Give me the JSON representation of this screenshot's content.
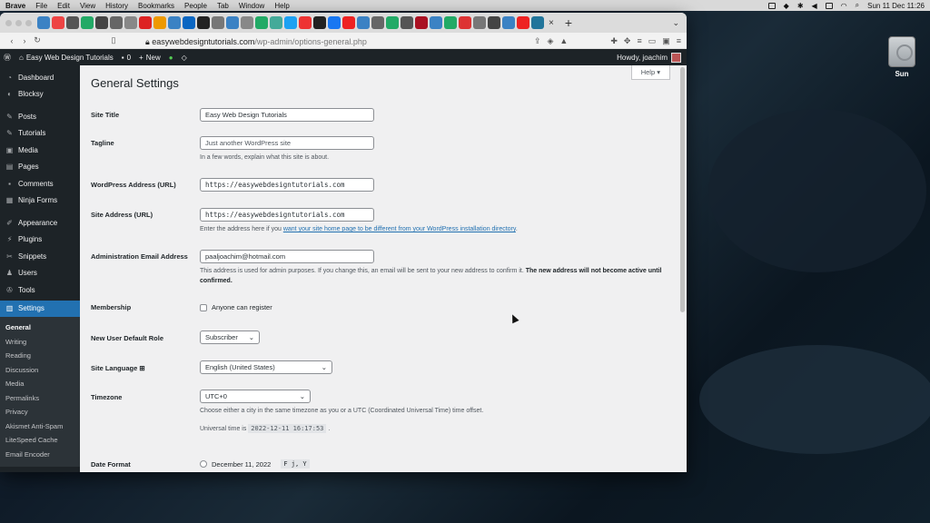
{
  "menubar": {
    "app": "Brave",
    "items": [
      "File",
      "Edit",
      "View",
      "History",
      "Bookmarks",
      "People",
      "Tab",
      "Window",
      "Help"
    ],
    "clock": "Sun 11 Dec  11:26"
  },
  "desktop": {
    "icon_label": "Sun"
  },
  "browser": {
    "url_host": "easywebdesigntutorials.com",
    "url_path": "/wp-admin/options-general.php",
    "tab_close": "×",
    "new_tab": "+"
  },
  "adminbar": {
    "site_name": "Easy Web Design Tutorials",
    "comments_count": "0",
    "new_label": "New",
    "howdy": "Howdy, joachim"
  },
  "sidebar": {
    "items": [
      {
        "label": "Dashboard",
        "icon": "dashboard-icon"
      },
      {
        "label": "Blocksy",
        "icon": "blocksy-icon"
      },
      {
        "label": "Posts",
        "icon": "pin-icon"
      },
      {
        "label": "Tutorials",
        "icon": "pin-icon"
      },
      {
        "label": "Media",
        "icon": "media-icon"
      },
      {
        "label": "Pages",
        "icon": "page-icon"
      },
      {
        "label": "Comments",
        "icon": "comment-icon"
      },
      {
        "label": "Ninja Forms",
        "icon": "forms-icon"
      },
      {
        "label": "Appearance",
        "icon": "brush-icon"
      },
      {
        "label": "Plugins",
        "icon": "plugin-icon"
      },
      {
        "label": "Snippets",
        "icon": "snippet-icon"
      },
      {
        "label": "Users",
        "icon": "user-icon"
      },
      {
        "label": "Tools",
        "icon": "wrench-icon"
      },
      {
        "label": "Settings",
        "icon": "settings-icon"
      }
    ],
    "submenu": [
      "General",
      "Writing",
      "Reading",
      "Discussion",
      "Media",
      "Permalinks",
      "Privacy",
      "Akismet Anti-Spam",
      "LiteSpeed Cache",
      "Email Encoder"
    ]
  },
  "page": {
    "title": "General Settings",
    "help": "Help ▾",
    "site_title_label": "Site Title",
    "site_title_value": "Easy Web Design Tutorials",
    "tagline_label": "Tagline",
    "tagline_placeholder": "Just another WordPress site",
    "tagline_desc": "In a few words, explain what this site is about.",
    "wp_address_label": "WordPress Address (URL)",
    "wp_address_value": "https://easywebdesigntutorials.com",
    "site_address_label": "Site Address (URL)",
    "site_address_value": "https://easywebdesigntutorials.com",
    "site_address_desc_pre": "Enter the address here if you ",
    "site_address_desc_link": "want your site home page to be different from your WordPress installation directory",
    "site_address_desc_post": ".",
    "admin_email_label": "Administration Email Address",
    "admin_email_value": "paaljoachim@hotmail.com",
    "admin_email_desc": "This address is used for admin purposes. If you change this, an email will be sent to your new address to confirm it. ",
    "admin_email_desc_bold": "The new address will not become active until confirmed.",
    "membership_label": "Membership",
    "membership_check": "Anyone can register",
    "default_role_label": "New User Default Role",
    "default_role_value": "Subscriber",
    "language_label": "Site Language",
    "language_value": "English (United States)",
    "timezone_label": "Timezone",
    "timezone_value": "UTC+0",
    "timezone_desc": "Choose either a city in the same timezone as you or a UTC (Coordinated Universal Time) time offset.",
    "universal_time_pre": "Universal time is ",
    "universal_time_value": "2022-12-11 16:17:53",
    "universal_time_post": " .",
    "date_format_label": "Date Format",
    "date_option": "December 11, 2022",
    "date_code": "F j, Y"
  }
}
